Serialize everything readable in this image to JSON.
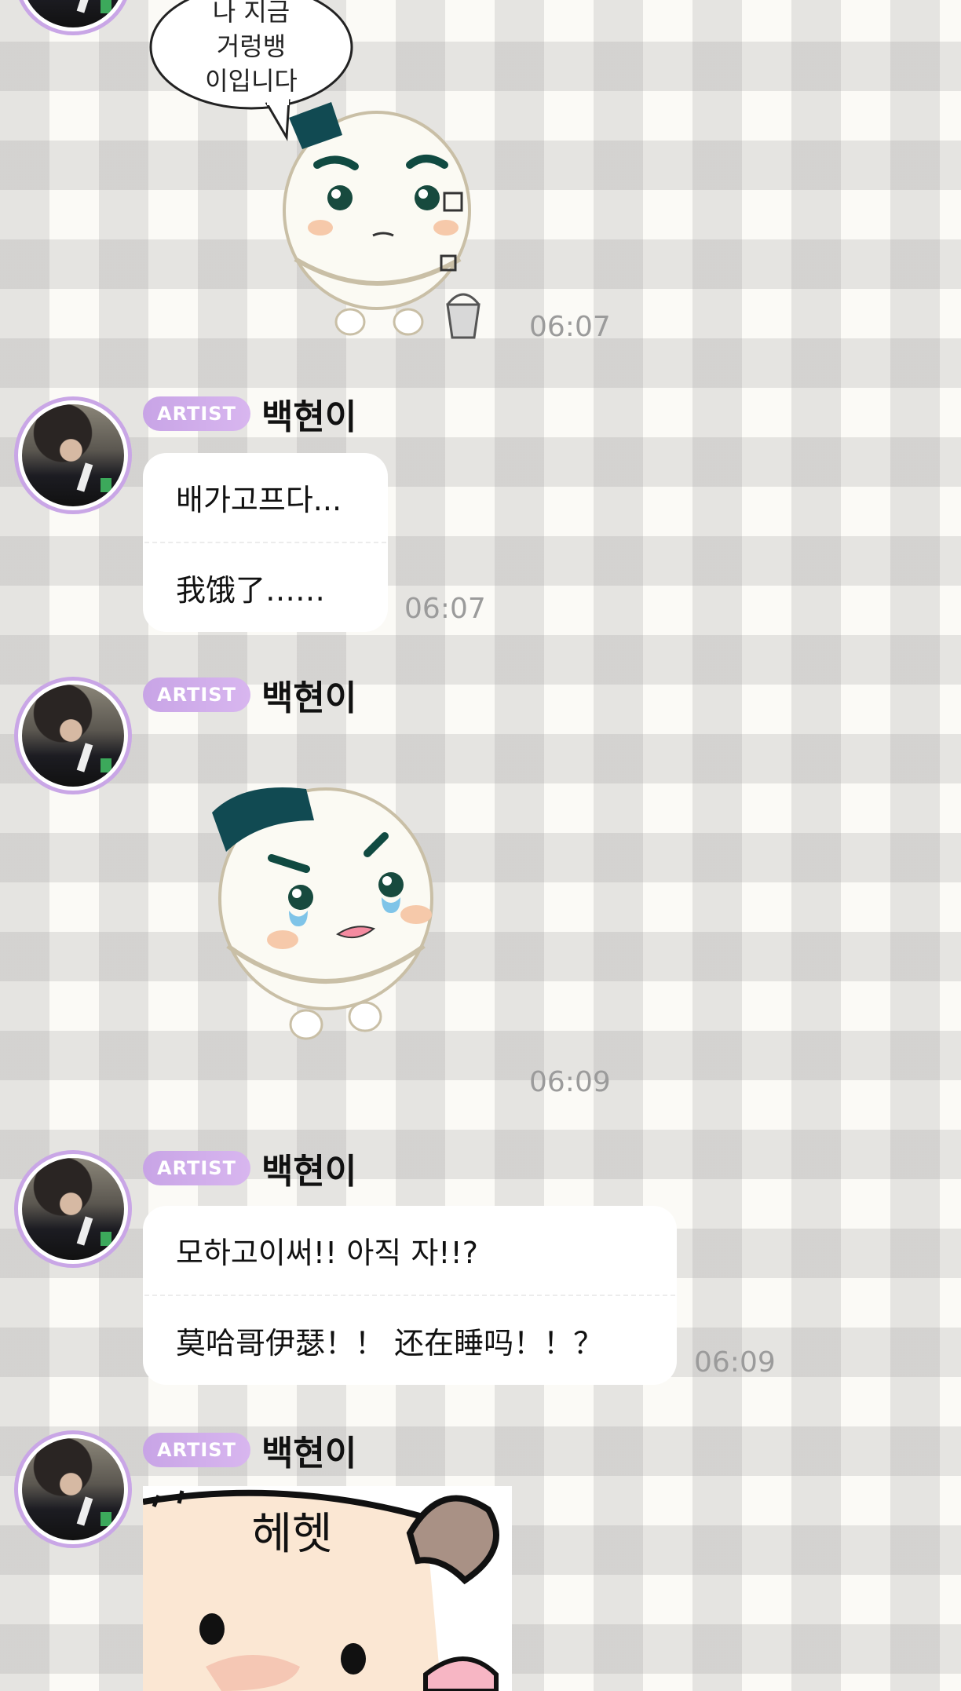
{
  "messages": [
    {
      "type": "sticker",
      "sticker_name": "rice-ball-speech-sticker",
      "sticker_text": "나 지금\n거렁뱅\n이입니다",
      "time": "06:07"
    },
    {
      "type": "text",
      "badge": "ARTIST",
      "name": "백현이",
      "lines": [
        "배가고프다...",
        "我饿了……"
      ],
      "time": "06:07"
    },
    {
      "type": "sticker",
      "badge": "ARTIST",
      "name": "백현이",
      "sticker_name": "crying-rice-ball-sticker",
      "time": "06:09"
    },
    {
      "type": "text",
      "badge": "ARTIST",
      "name": "백현이",
      "lines": [
        "모하고이써!! 아직 자!!?",
        "莫哈哥伊瑟！！ 还在睡吗！！？"
      ],
      "time": "06:09"
    },
    {
      "type": "sticker",
      "badge": "ARTIST",
      "name": "백현이",
      "sticker_name": "hehet-pig-sticker",
      "sticker_text": "헤헷"
    }
  ],
  "colors": {
    "badge_gradient_start": "#c8a4e6",
    "badge_gradient_end": "#d8b6ef",
    "avatar_ring": "#c9a6e6",
    "timestamp": "#9b9b9b",
    "bubble_bg": "#ffffff"
  }
}
